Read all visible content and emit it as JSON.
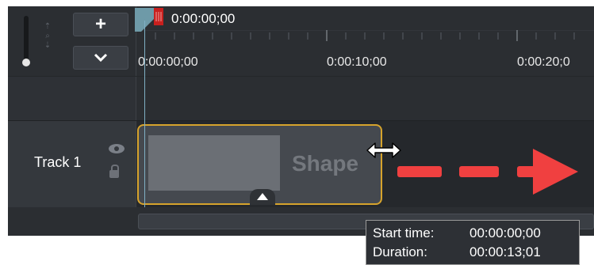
{
  "playhead": {
    "time": "0:00:00;00"
  },
  "ruler": {
    "labels": [
      "0:00:00;00",
      "0:00:10;00",
      "0:00:20;0"
    ]
  },
  "controls": {
    "add_label": "+",
    "collapse_label": "⌄"
  },
  "track": {
    "name": "Track 1"
  },
  "clip": {
    "label": "Shape"
  },
  "tooltip": {
    "start_label": "Start time:",
    "start_value": "00:00:00;00",
    "duration_label": "Duration:",
    "duration_value": "00:00:13;01"
  },
  "colors": {
    "clip_border": "#d6a32c",
    "arrow": "#f04040",
    "playhead": "#c8201e",
    "background": "#2b2e32"
  },
  "icons": [
    "zoom-icon",
    "add-icon",
    "chevron-down-icon",
    "eye-icon",
    "lock-icon",
    "resize-horizontal-icon",
    "arrow-right-icon"
  ]
}
